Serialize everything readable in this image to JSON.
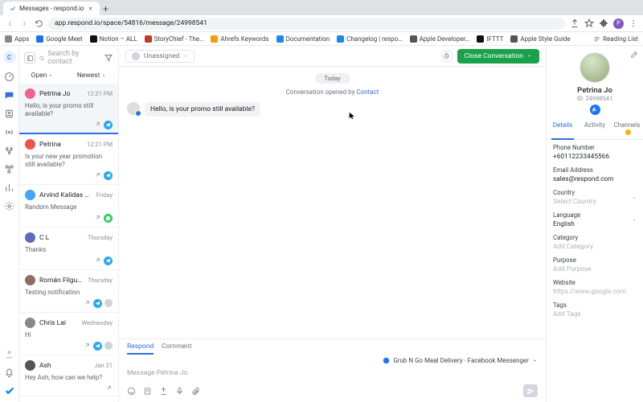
{
  "browser": {
    "tab_title": "Messages - respond.io",
    "url": "app.respond.io/space/54816/message/24998541",
    "bookmarks": [
      "Apps",
      "Google Meet",
      "Notion – ALL",
      "StoryChief - The…",
      "Ahrefs Keywords",
      "Documentation",
      "Changelog | respo…",
      "Apple Developer…",
      "IFTTT",
      "Apple Style Guide"
    ],
    "reading_list": "Reading List"
  },
  "rail": {
    "workspace_letter": "C"
  },
  "conv_list": {
    "search_placeholder": "Search by contact",
    "filters": {
      "status": "Open",
      "sort": "Newest"
    },
    "items": [
      {
        "name": "Petrina Jo",
        "time": "12:21 PM",
        "snippet": "Hello, is your promo still available?",
        "channel": "tg",
        "active": true
      },
      {
        "name": "Petrina",
        "time": "12:21 PM",
        "snippet": "Is your new year promotion still available?",
        "channel": "tg"
      },
      {
        "name": "Arvind Kalidas Nair",
        "time": "Friday",
        "snippet": "Random Message",
        "channel": "wa"
      },
      {
        "name": "C L",
        "time": "Thursday",
        "snippet": "Thanks",
        "channel": "tg"
      },
      {
        "name": "Román Filgueira",
        "time": "Thursday",
        "snippet": "Testing notification",
        "channel": "tg",
        "extra_avatars": true
      },
      {
        "name": "Chris Lai",
        "time": "Wednesday",
        "snippet": "Hi",
        "channel": "tg",
        "extra_avatars": true
      },
      {
        "name": "Ash",
        "time": "Jan 21",
        "snippet": "Hey Ash, how can we help?",
        "channel": ""
      }
    ]
  },
  "thread": {
    "assignee": "Unassigned",
    "close_label": "Close Conversation",
    "date_pill": "Today",
    "sys_prefix": "Conversation opened by ",
    "sys_link": "Contact",
    "message": "Hello, is your promo still available?",
    "composer_tabs": {
      "respond": "Respond",
      "comment": "Comment"
    },
    "channel_line": "Grub N Go Meal Delivery · Facebook Messenger",
    "compose_placeholder": "Message Petrina Jo"
  },
  "details": {
    "name": "Petrina Jo",
    "id_label": "ID: 24998541",
    "tabs": {
      "details": "Details",
      "activity": "Activity",
      "channels": "Channels"
    },
    "fields": {
      "phone_label": "Phone Number",
      "phone": "+60112233445566",
      "email_label": "Email Address",
      "email": "sales@respond.com",
      "country_label": "Country",
      "country_ph": "Select Country",
      "lang_label": "Language",
      "lang": "English",
      "category_label": "Category",
      "category_ph": "Add Category",
      "purpose_label": "Purpose",
      "purpose_ph": "Add Purpose",
      "website_label": "Website",
      "website": "https://www.google.com",
      "tags_label": "Tags",
      "tags_ph": "Add Tags"
    }
  }
}
